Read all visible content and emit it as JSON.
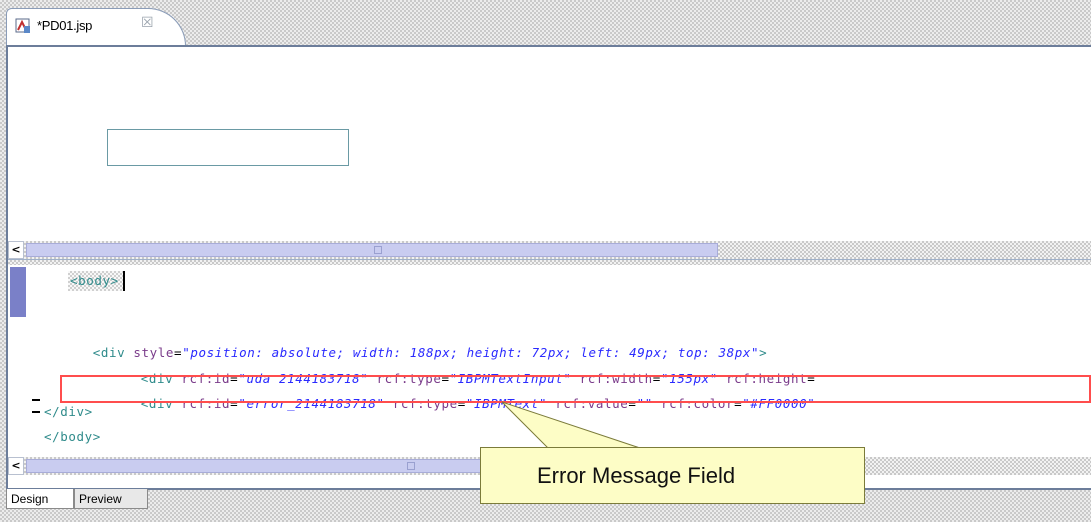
{
  "editor_tab": {
    "title": "*PD01.jsp",
    "close_glyph": "☒",
    "icon": "jsp-file-icon"
  },
  "scrollbar": {
    "left_arrow": "<",
    "grip": "≡"
  },
  "source": {
    "line1": "<body>",
    "line2": {
      "open": "<div ",
      "attr1": "style",
      "eq": "=",
      "val1": "\"position: absolute; width: 188px; height: 72px; left: 49px; top: 38px\"",
      "close": ">"
    },
    "line3": {
      "open": "<div ",
      "a1": "rcf:id",
      "v1": "\"uda 2144183718\"",
      "a2": "rcf:type",
      "v2": "\"IBPMTextInput\"",
      "a3": "rcf:width",
      "v3": "\"155px\"",
      "a4": "rcf:height",
      "eq": "="
    },
    "line4": {
      "open": "<div ",
      "a1": "rcf:id",
      "v1": "\"error_2144183718\"",
      "a2": "rcf:type",
      "v2": "\"IBPMText\"",
      "a3": "rcf:value",
      "v3": "\"\"",
      "a4": "rcf:color",
      "v4": "\"#FF0000\""
    },
    "line5": "</div>",
    "line6": "</body>"
  },
  "bottom_tabs": {
    "design": "Design",
    "preview": "Preview"
  },
  "callout": {
    "text": "Error Message Field"
  },
  "colors": {
    "tag": "#2f8b8b",
    "attribute": "#7a3b8a",
    "value": "#2a2aff",
    "highlight": "#ff4d4d",
    "callout_bg": "#fdfdc6"
  }
}
